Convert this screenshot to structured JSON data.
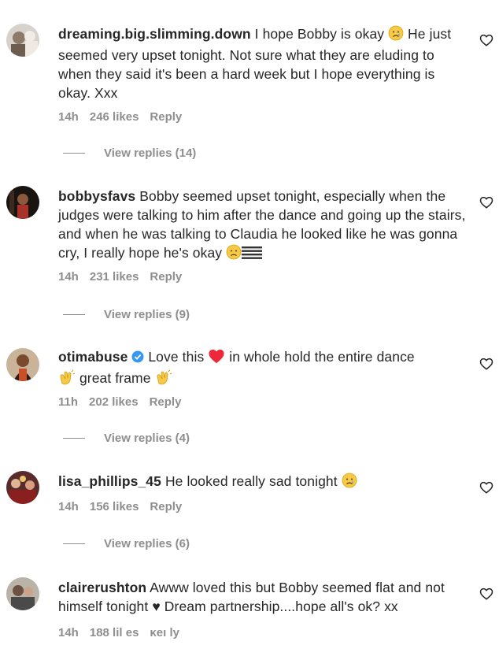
{
  "colors": {
    "text": "#262626",
    "meta": "#8e8e8e",
    "heart_red": "#ed2939",
    "verified": "#3897f0"
  },
  "comments": [
    {
      "username": "dreaming.big.slimming.down",
      "text_a": " I hope Bobby is okay ",
      "emoji_a": "crying-face-icon",
      "text_b": "  He just seemed very upset tonight. Not sure what they are eluding to when they said it's been a hard week but I hope everything is okay. Xxx",
      "time": "14h",
      "likes": "246 likes",
      "reply": "Reply",
      "view_replies": "View replies (14)"
    },
    {
      "username": "bobbysfavs",
      "text_a": " Bobby seemed upset tonight, especially when the judges were talking to him after the dance and going up the stairs, and when he was talking to Claudia he looked like he was gonna cry, I really hope he's okay ",
      "emoji_a": "slightly-frowning-face-icon",
      "time": "14h",
      "likes": "231 likes",
      "reply": "Reply",
      "view_replies": "View replies (9)"
    },
    {
      "username": "otimabuse",
      "text_a": " Love this ",
      "emoji_a": "red-heart-icon",
      "text_b": " in whole hold the entire dance",
      "text_c": " great frame ",
      "time": "11h",
      "likes": "202 likes",
      "reply": "Reply",
      "view_replies": "View replies (4)"
    },
    {
      "username": "lisa_phillips_45",
      "text_a": " He looked really sad tonight ",
      "emoji_a": "crying-face-icon",
      "time": "14h",
      "likes": "156 likes",
      "reply": "Reply",
      "view_replies": "View replies (6)"
    },
    {
      "username": "clairerushton",
      "text_a": " Awww loved this but Bobby seemed flat and not himself tonight ",
      "symbol": "♥",
      "text_b": " Dream partnership....hope all's ok? xx",
      "time": "14h",
      "likes": "188 lil es",
      "reply": "κеı lу"
    }
  ]
}
